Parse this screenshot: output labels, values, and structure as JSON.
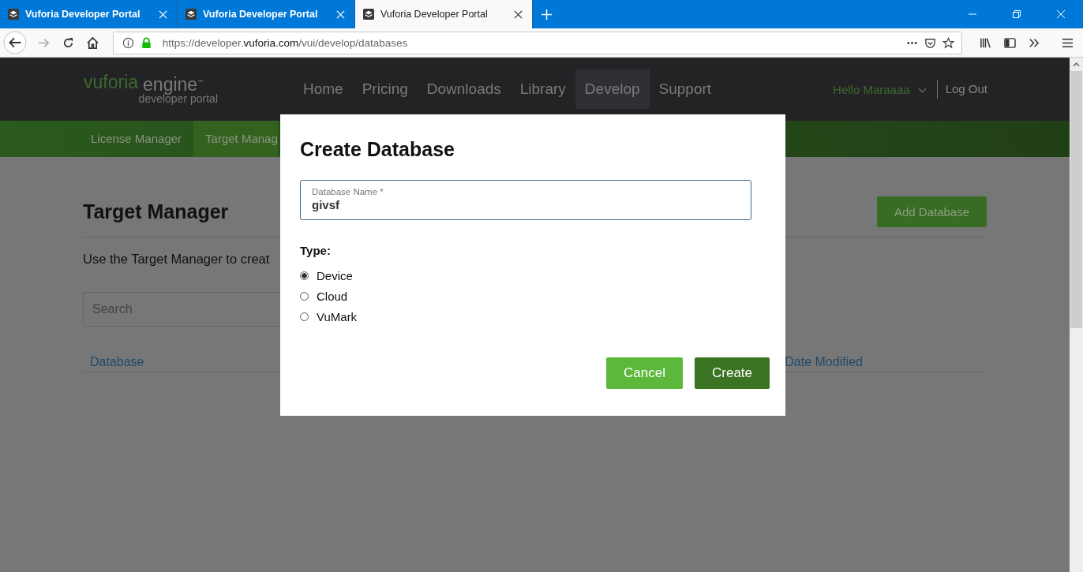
{
  "browser": {
    "tabs": [
      {
        "title": "Vuforia Developer Portal",
        "selected": false
      },
      {
        "title": "Vuforia Developer Portal",
        "selected": false
      },
      {
        "title": "Vuforia Developer Portal",
        "selected": true
      }
    ],
    "address_bar": {
      "prefix": "https://developer.",
      "domain": "vuforia.com",
      "path": "/vui/develop/databases"
    }
  },
  "site_header": {
    "logo": {
      "brand": "vuforia",
      "product": "engine$^{™}$",
      "tagline": "developer portal"
    },
    "nav": [
      {
        "label": "Home",
        "selected": false
      },
      {
        "label": "Pricing",
        "selected": false
      },
      {
        "label": "Downloads",
        "selected": false
      },
      {
        "label": "Library",
        "selected": false
      },
      {
        "label": "Develop",
        "selected": true
      },
      {
        "label": "Support",
        "selected": false
      }
    ],
    "user_menu": "Hello Maraaaa",
    "logout": "Log Out"
  },
  "subnav": [
    {
      "label": "License Manager",
      "selected": false
    },
    {
      "label": "Target Manag",
      "selected": true
    }
  ],
  "page": {
    "title": "Target Manager",
    "add_button": "Add Database",
    "intro": "Use the Target Manager to creat",
    "search": {
      "placeholder": "Search"
    },
    "table": {
      "columns": [
        "Database",
        "Date Modified"
      ]
    }
  },
  "modal": {
    "title": "Create Database",
    "field": {
      "label": "Database Name *",
      "value": "givsf"
    },
    "type_label": "Type:",
    "options": [
      {
        "label": "Device",
        "selected": true
      },
      {
        "label": "Cloud",
        "selected": false
      },
      {
        "label": "VuMark",
        "selected": false
      }
    ],
    "buttons": [
      {
        "label": "Cancel",
        "kind": "secondary"
      },
      {
        "label": "Create",
        "kind": "primary"
      }
    ]
  }
}
